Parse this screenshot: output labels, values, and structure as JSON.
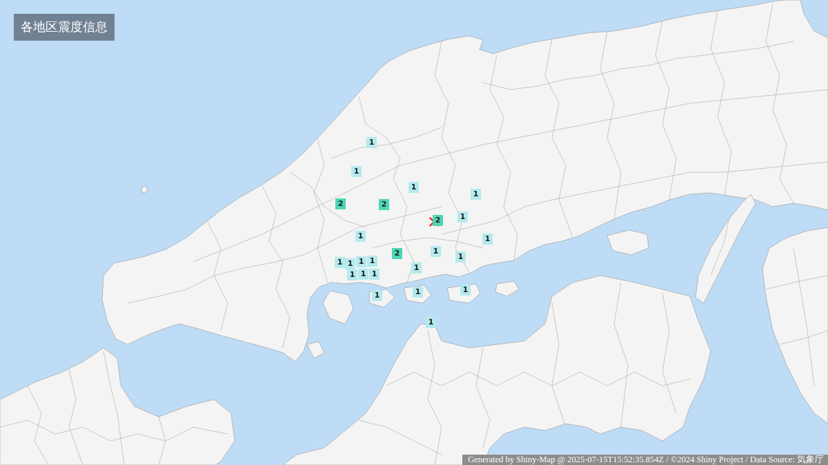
{
  "title": "各地区震度信息",
  "markers": [
    {
      "intensity": "1",
      "color": "#b4eaee"
    },
    {
      "intensity": "1",
      "color": "#b4eaee"
    },
    {
      "intensity": "1",
      "color": "#b4eaee"
    },
    {
      "intensity": "1",
      "color": "#b4eaee"
    },
    {
      "intensity": "2",
      "color": "#4dd6b5"
    },
    {
      "intensity": "2",
      "color": "#4dd6b5"
    },
    {
      "intensity": "1",
      "color": "#b4eaee"
    },
    {
      "intensity": "2",
      "color": "#4dd6b5"
    },
    {
      "intensity": "1",
      "color": "#b4eaee"
    },
    {
      "intensity": "1",
      "color": "#b4eaee"
    },
    {
      "intensity": "1",
      "color": "#b4eaee"
    },
    {
      "intensity": "2",
      "color": "#4dd6b5"
    },
    {
      "intensity": "1",
      "color": "#b4eaee"
    },
    {
      "intensity": "1",
      "color": "#b4eaee"
    },
    {
      "intensity": "1",
      "color": "#b4eaee"
    },
    {
      "intensity": "1",
      "color": "#b4eaee"
    },
    {
      "intensity": "1",
      "color": "#b4eaee"
    },
    {
      "intensity": "1",
      "color": "#b4eaee"
    },
    {
      "intensity": "1",
      "color": "#b4eaee"
    },
    {
      "intensity": "1",
      "color": "#b4eaee"
    },
    {
      "intensity": "1",
      "color": "#b4eaee"
    },
    {
      "intensity": "1",
      "color": "#b4eaee"
    },
    {
      "intensity": "1",
      "color": "#b4eaee"
    },
    {
      "intensity": "1",
      "color": "#b4eaee"
    },
    {
      "intensity": "1",
      "color": "#b4eaee"
    }
  ],
  "footer": "Generated by Shiny-Map @ 2025-07-15T15:52:35.854Z / ©2024 Shiny Project / Data Source: 気象庁"
}
